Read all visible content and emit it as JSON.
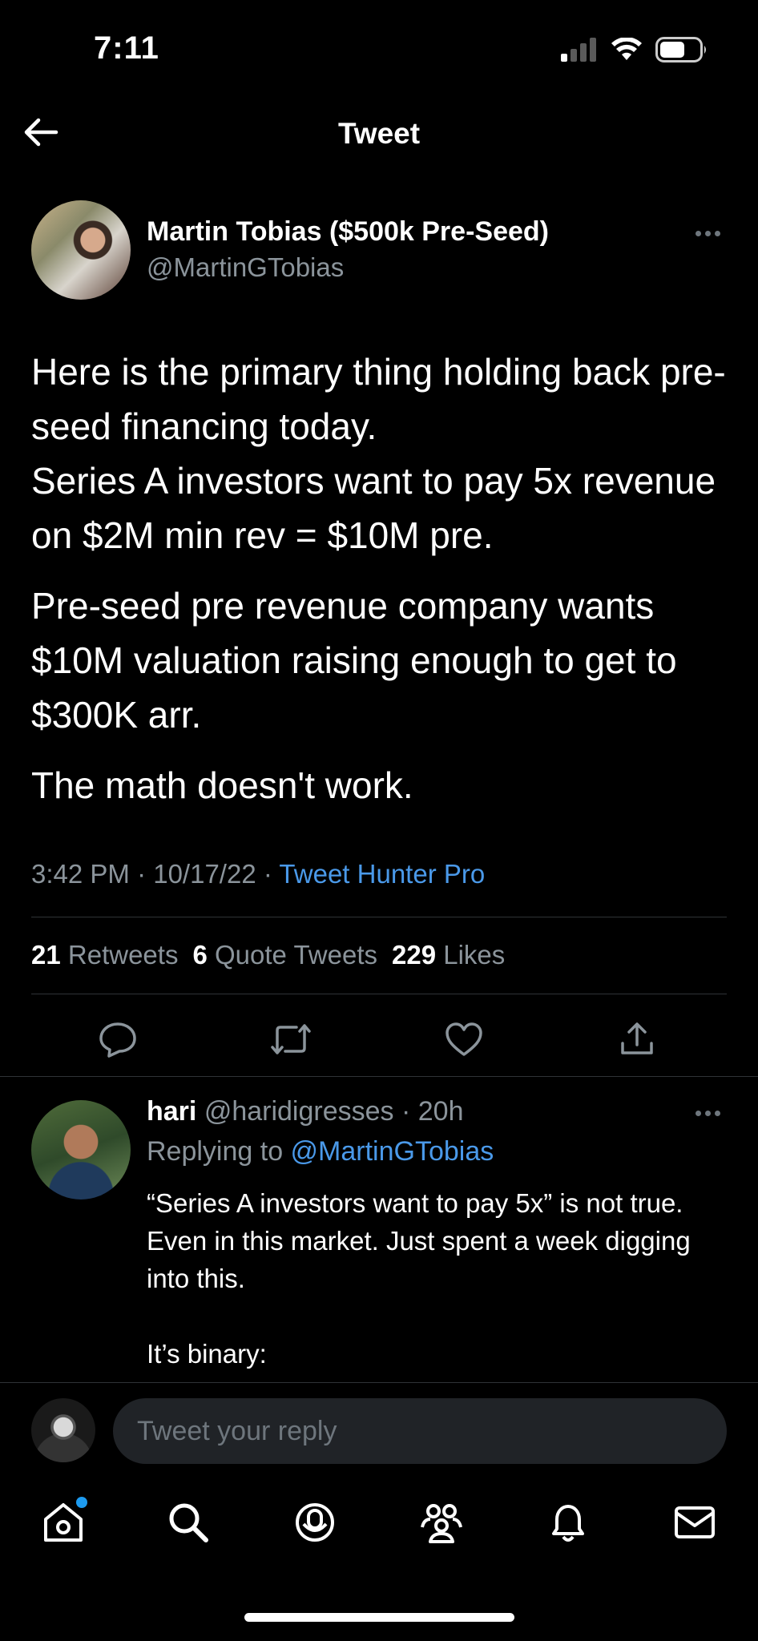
{
  "status_bar": {
    "time": "7:11"
  },
  "nav": {
    "title": "Tweet"
  },
  "tweet": {
    "author_name": "Martin Tobias ($500k Pre-Seed)",
    "author_handle": "@MartinGTobias",
    "paragraphs": [
      "Here is the primary thing holding back pre-seed financing today.\nSeries A investors want to pay 5x revenue on $2M min rev = $10M pre.",
      "Pre-seed pre revenue company wants $10M valuation raising enough to get to $300K arr.",
      "The math doesn't work."
    ],
    "timestamp": "3:42 PM · 10/17/22 · ",
    "source": "Tweet Hunter Pro",
    "stats": {
      "retweets_count": "21",
      "retweets_label": "Retweets",
      "quotes_count": "6",
      "quotes_label": "Quote Tweets",
      "likes_count": "229",
      "likes_label": "Likes"
    }
  },
  "actions": [
    "reply-icon",
    "retweet-icon",
    "like-icon",
    "share-icon"
  ],
  "reply": {
    "name": "hari",
    "handle_time": "@haridigresses · 20h",
    "replying_prefix": "Replying to ",
    "replying_to": "@MartinGTobias",
    "paragraphs": [
      "“Series A investors want to pay 5x” is not true. Even in this market. Just spent a week digging into this.",
      "It’s binary:"
    ]
  },
  "compose": {
    "placeholder": "Tweet your reply"
  },
  "tab_bar": {
    "items": [
      "home-icon",
      "search-icon",
      "spaces-icon",
      "communities-icon",
      "notifications-icon",
      "messages-icon"
    ],
    "home_has_notification": true
  },
  "colors": {
    "background": "#000000",
    "link": "#4a99e9",
    "secondary_text": "#8b949b",
    "divider": "#2f3336"
  }
}
